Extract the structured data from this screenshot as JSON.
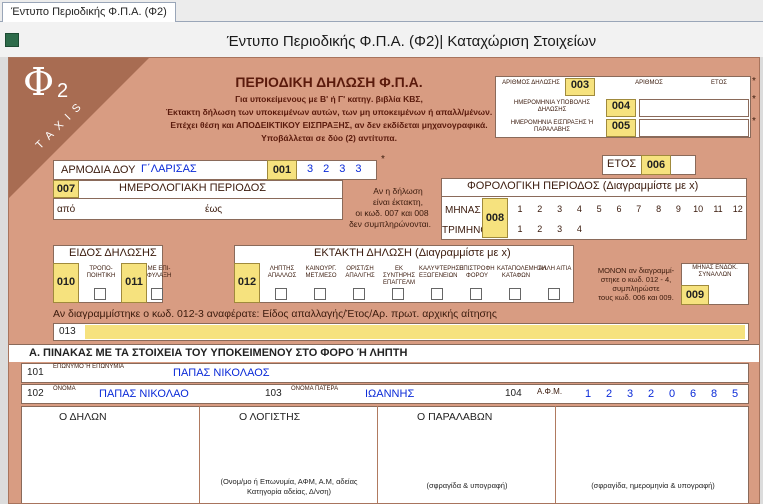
{
  "tab": "Έντυπο Περιοδικής Φ.Π.Α. (Φ2)",
  "window_title": "Έντυπο Περιοδικής Φ.Π.Α. (Φ2)| Καταχώριση Στοιχείων",
  "logo": {
    "letter": "Φ",
    "sub": "2",
    "taxis": "T A X I S"
  },
  "header": {
    "title": "ΠΕΡΙΟΔΙΚΗ ΔΗΛΩΣΗ Φ.Π.Α.",
    "l1": "Για υποκείμενους με Β' ή Γ' κατηγ. βιβλία ΚΒΣ,",
    "l2": "Έκτακτη δήλωση των υποκειμένων αυτών, των μη υποκειμένων ή απαλλ/μένων.",
    "l3": "Επέχει θέση και ΑΠΟΔΕΙΚΤΙΚΟΥ ΕΙΣΠΡΑΞΗΣ, αν δεν εκδίδεται μηχανογραφικά.",
    "l4": "Υποβάλλεται σε δύο (2) αντίτυπα."
  },
  "topright": {
    "r1": "ΑΡΙΘΜΟΣ ΔΗΛΩΣΗΣ",
    "c1": "003",
    "h_num": "ΑΡΙΘΜΟΣ",
    "h_year": "ΕΤΟΣ",
    "r2": "ΗΜΕΡΟΜΗΝΙΑ ΥΠΟΒΟΛΗΣ ΔΗΛΩΣΗΣ",
    "c2": "004",
    "r3": "ΗΜΕΡΟΜΗΝΙΑ ΕΙΣΠΡΑΞΗΣ Ή ΠΑΡΑΛΑΒΗΣ",
    "c3": "005",
    "star": "*"
  },
  "doy": {
    "label": "ΑΡΜΟΔΙΑ ΔΟΥ",
    "value": "Γ΄ΛΑΡΙΣΑΣ",
    "code": "001",
    "digits": [
      "3",
      "2",
      "3",
      "3"
    ]
  },
  "year": {
    "label": "ΕΤΟΣ",
    "code": "006"
  },
  "period": {
    "code": "007",
    "label": "ΗΜΕΡΟΛΟΓΙΑΚΗ ΠΕΡΙΟΔΟΣ",
    "from": "από",
    "to": "έως",
    "note1": "Αν η δήλωση",
    "note2": "είναι έκτακτη,",
    "note3": "οι κωδ. 007 και 008",
    "note4": "δεν συμπληρώνονται."
  },
  "tax_period": {
    "label": "ΦΟΡΟΛΟΓΙΚΗ ΠΕΡΙΟΔΟΣ",
    "hint": "(Διαγραμμίστε με x)",
    "month_label": "ΜΗΝΑΣ",
    "quarter_label": "ΤΡΙΜΗΝΟ",
    "code": "008",
    "months": [
      "1",
      "2",
      "3",
      "4",
      "5",
      "6",
      "7",
      "8",
      "9",
      "10",
      "11",
      "12"
    ],
    "quarters": [
      "1",
      "2",
      "3",
      "4"
    ]
  },
  "decl_type": {
    "label": "ΕΙΔΟΣ ΔΗΛΩΣΗΣ",
    "c010": "010",
    "t010": "ΤΡΟΠΟ- ΠΟΙΗΤΙΚΗ",
    "c011": "011",
    "t011": "ΜΕ ΕΠΙ- ΦΥΛΑΞΗ"
  },
  "extra": {
    "label": "ΕΚΤΑΚΤΗ ΔΗΛΩΣΗ",
    "hint": "(Διαγραμμίστε με x)",
    "code": "012",
    "opts": [
      "ΛΗΠΤΗΣ ΑΠΑΛΛΟΣ",
      "ΚΑΙΝΟΥΡΓ. ΜΕΤ.ΜΕΣΟ",
      "ΟΡΙΣΤ/ΣΗ ΑΠΑΛ/ΓΗΣ",
      "ΕΚ ΣΥΝΤΗΡΗΣ ΕΠΑΓΓΕΛΜ",
      "ΚΑΛΥΨΤΕΡΗΣΗ ΕΞΩΓΕΝΕΙΩΝ",
      "ΕΠΙΣΤΡΟΦΗ ΦΟΡΟΥ",
      "ΚΑΤΑΠΟΛΕΜΗΣΗ ΚΑΤΑΦΩΝ",
      "ΑΛΛΗ ΑΙΤΙΑ"
    ]
  },
  "month_note": {
    "n1": "ΜΟΝΟΝ αν διαγραμμί-",
    "n2": "στηκε ο κωδ. 012 - 4,",
    "n3": "συμπληρώστε",
    "n4": "τους κωδ. 006 και 009.",
    "label": "ΜΗΝΑΣ ΕΝΔΟΚ. ΣΥΝΑΛΛΩΝ",
    "code": "009"
  },
  "row013": {
    "note": "Αν διαγραμμίστηκε ο κωδ. 012-3 αναφέρατε: Είδος απαλλαγής/Έτος/Αρ. πρωτ. αρχικής αίτησης",
    "code": "013"
  },
  "section_a": "Α. ΠΙΝΑΚΑΣ ΜΕ ΤΑ ΣΤΟΙΧΕΙΑ ΤΟΥ ΥΠΟΚΕΙΜΕΝΟΥ ΣΤΟ ΦΟΡΟ Ή ΛΗΠΤΗ",
  "r101": {
    "code": "101",
    "label": "ΕΠΩΝΥΜΟ Ή ΕΠΩΝΥΜΙΑ",
    "value": "ΠΑΠΑΣ ΝΙΚΟΛΑΟΣ"
  },
  "r102": {
    "code": "102",
    "label": "ΟΝΟΜΑ",
    "value": "ΠΑΠΑΣ ΝΙΚΟΛΑΟ",
    "c103": "103",
    "l103": "ΟΝΟΜΑ ΠΑΤΕΡΑ",
    "v103": "ΙΩΑΝΝΗΣ",
    "c104": "104",
    "l104": "Α.Φ.Μ.",
    "afm": [
      "1",
      "2",
      "3",
      "2",
      "0",
      "6",
      "8",
      "5"
    ]
  },
  "sign": {
    "s1": "Ο ΔΗΛΩΝ",
    "s2": "Ο ΛΟΓΙΣΤΗΣ",
    "s3": "Ο ΠΑΡΑΛΑΒΩΝ",
    "n2a": "(Ονομ/μο ή Επωνυμία, ΑΦΜ, Α.Μ, αδείας",
    "n2b": "Κατηγορία αδείας, Δ/νση)",
    "n3": "(σφραγίδα & υπογραφή)",
    "n4": "(σφραγίδα, ημερομηνία & υπογραφή)"
  }
}
